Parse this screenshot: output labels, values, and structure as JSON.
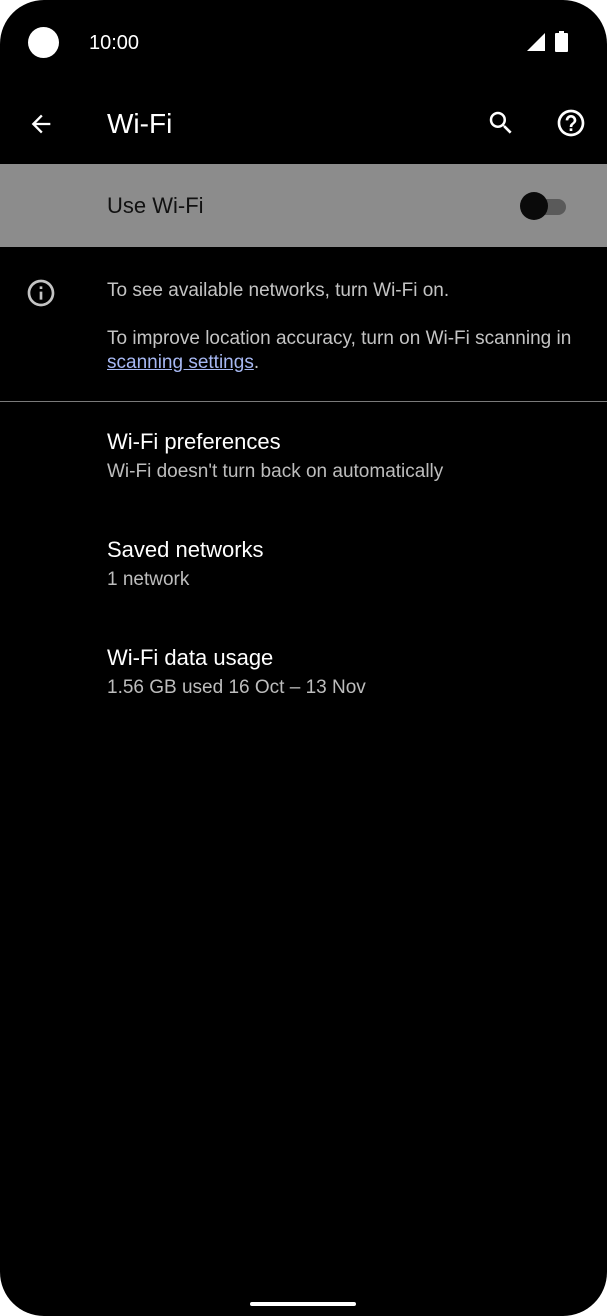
{
  "status_bar": {
    "time": "10:00",
    "icons": [
      "signal-icon",
      "battery-icon"
    ]
  },
  "app_bar": {
    "title": "Wi-Fi",
    "back_icon": "arrow-back-icon",
    "search_icon": "search-icon",
    "help_icon": "help-icon"
  },
  "master_switch": {
    "label": "Use Wi-Fi",
    "checked": false
  },
  "info": {
    "icon": "info-icon",
    "line1": "To see available networks, turn Wi-Fi on.",
    "line2_prefix": "To improve location accuracy, turn on Wi-Fi scanning in ",
    "link_text": "scanning settings",
    "line2_suffix": "."
  },
  "preferences": [
    {
      "title": "Wi-Fi preferences",
      "summary": "Wi-Fi doesn't turn back on automatically"
    },
    {
      "title": "Saved networks",
      "summary": "1 network"
    },
    {
      "title": "Wi-Fi data usage",
      "summary": "1.56 GB used 16 Oct – 13 Nov"
    }
  ],
  "colors": {
    "background": "#000000",
    "switch_bar": "#8c8c8c",
    "link": "#a7b8f2",
    "secondary_text": "#bdbdbd"
  }
}
